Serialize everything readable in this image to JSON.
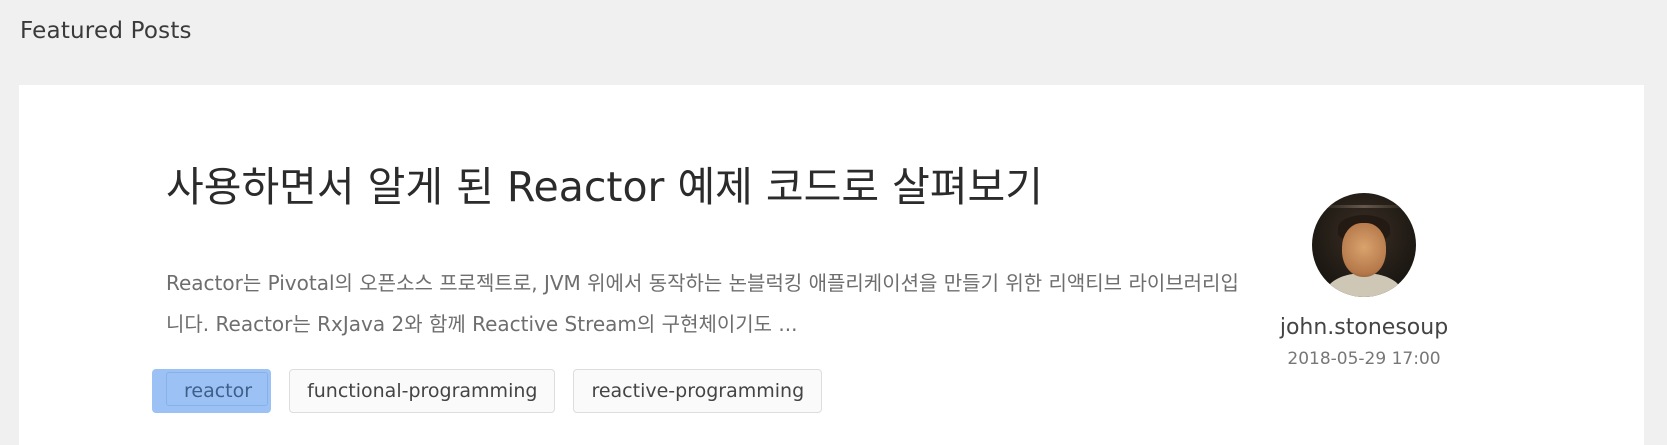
{
  "section": {
    "heading": "Featured Posts"
  },
  "post": {
    "title": "사용하면서 알게 된 Reactor 예제 코드로 살펴보기",
    "excerpt": "Reactor는 Pivotal의 오픈소스 프로젝트로, JVM 위에서 동작하는 논블럭킹 애플리케이션을 만들기 위한 리액티브 라이브러리입니다. Reactor는 RxJava 2와 함께 Reactive Stream의 구현체이기도 ...",
    "tags": [
      {
        "label": "reactor",
        "selected": true
      },
      {
        "label": "functional-programming",
        "selected": false
      },
      {
        "label": "reactive-programming",
        "selected": false
      }
    ],
    "author": {
      "name": "john.stonesoup",
      "date": "2018-05-29 17:00"
    }
  },
  "colors": {
    "page_background": "#f0f0f0",
    "card_background": "#ffffff",
    "selected_tag": "#9cc2f5"
  }
}
